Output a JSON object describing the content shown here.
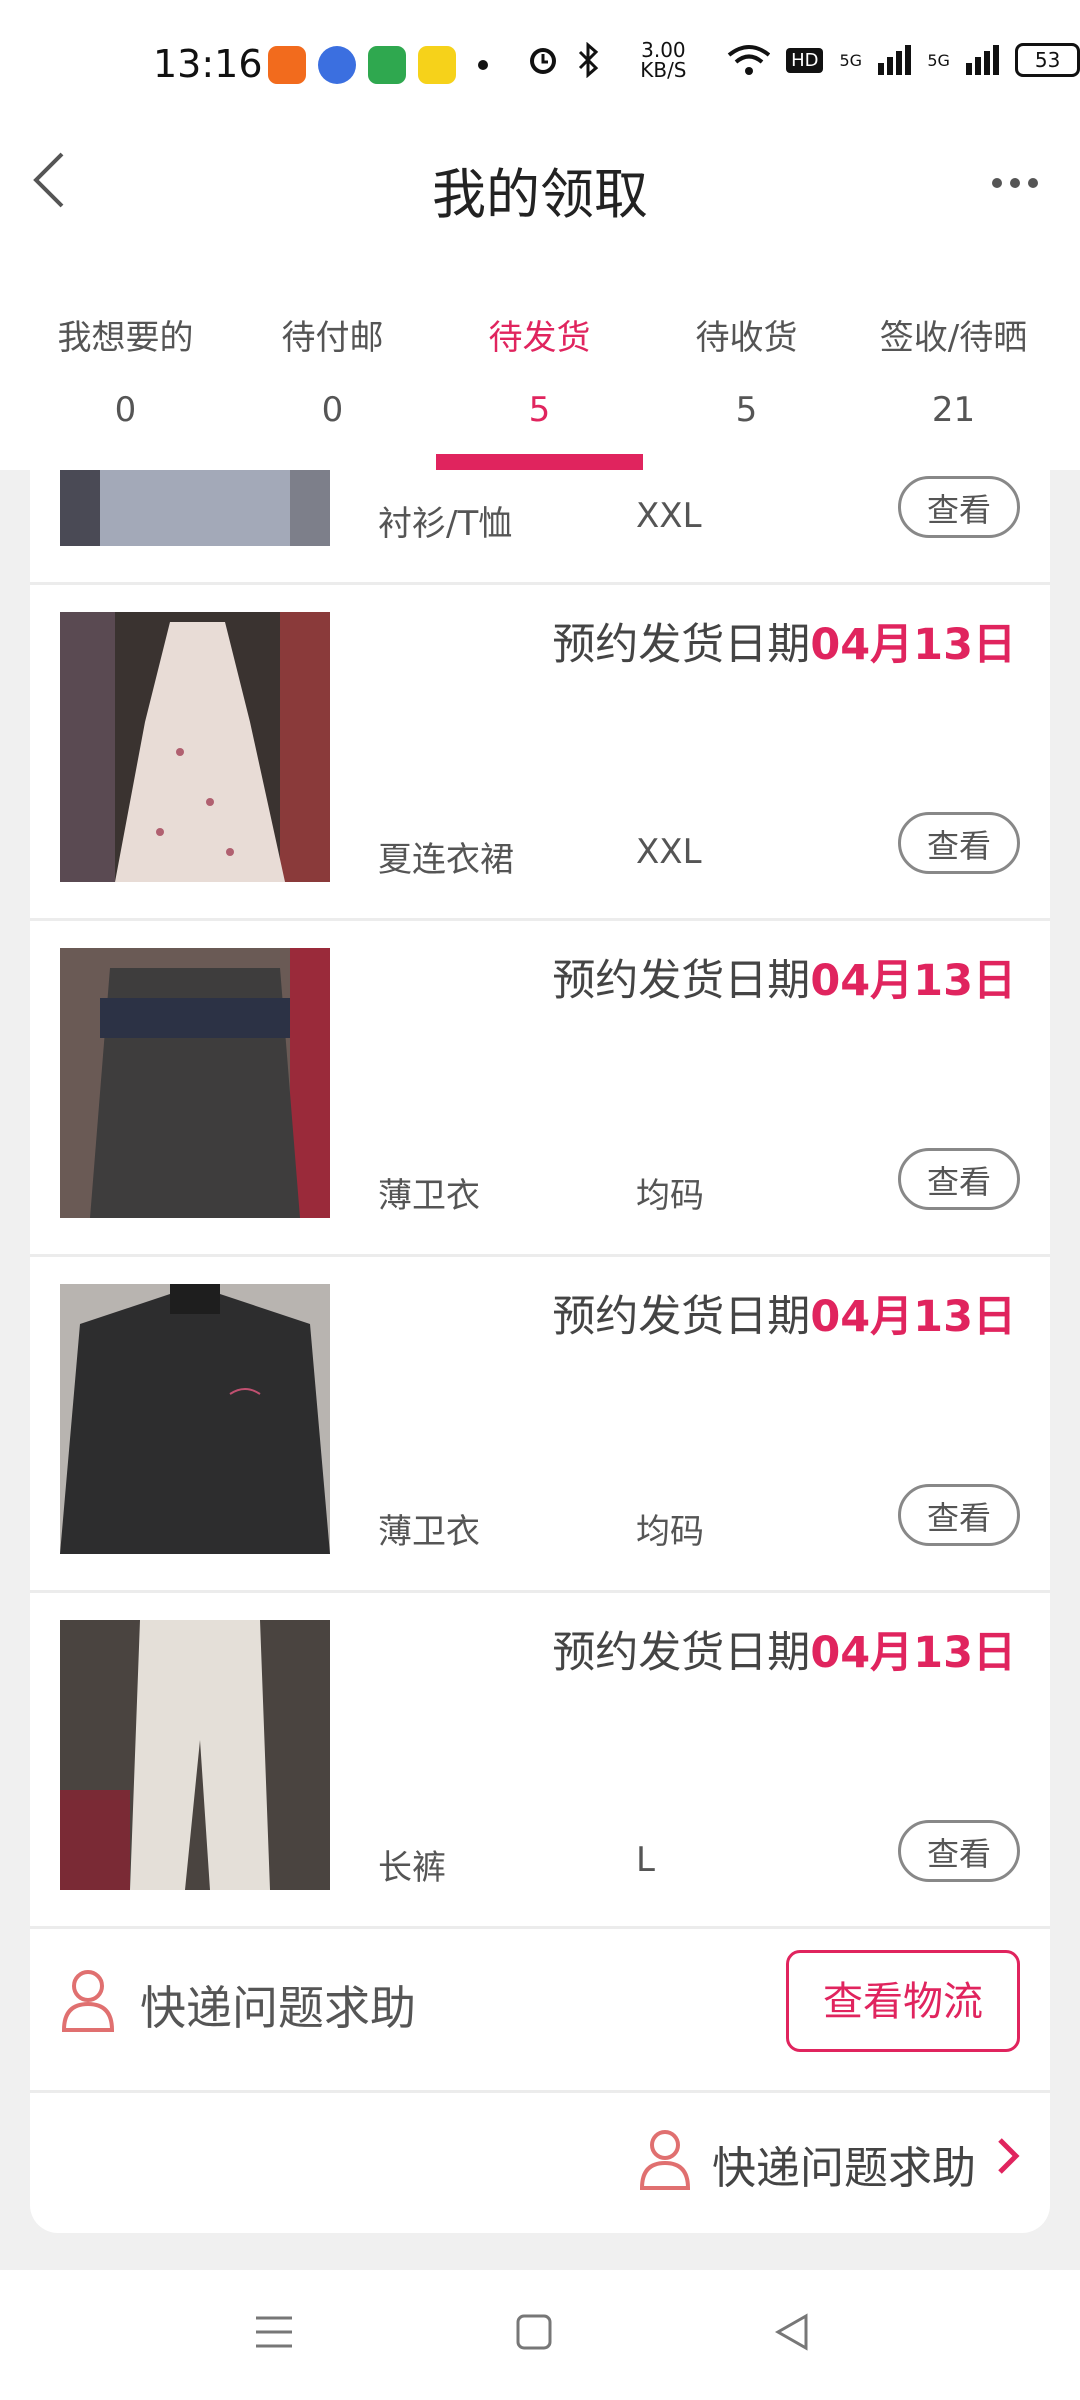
{
  "status": {
    "time": "13:16",
    "speed": "3.00 KB/S",
    "network": "5G",
    "battery": "53"
  },
  "header": {
    "title": "我的领取"
  },
  "tabs": [
    {
      "label": "我想要的",
      "count": "0"
    },
    {
      "label": "待付邮",
      "count": "0"
    },
    {
      "label": "待发货",
      "count": "5"
    },
    {
      "label": "待收货",
      "count": "5"
    },
    {
      "label": "签收/待晒",
      "count": "21"
    }
  ],
  "items": [
    {
      "category": "衬衫/T恤",
      "size": "XXL",
      "view_label": "查看"
    },
    {
      "date_prefix": "预约发货日期",
      "date_value": "04月13日",
      "category": "夏连衣裙",
      "size": "XXL",
      "view_label": "查看"
    },
    {
      "date_prefix": "预约发货日期",
      "date_value": "04月13日",
      "category": "薄卫衣",
      "size": "均码",
      "view_label": "查看"
    },
    {
      "date_prefix": "预约发货日期",
      "date_value": "04月13日",
      "category": "薄卫衣",
      "size": "均码",
      "view_label": "查看"
    },
    {
      "date_prefix": "预约发货日期",
      "date_value": "04月13日",
      "category": "长裤",
      "size": "L",
      "view_label": "查看"
    }
  ],
  "help": {
    "label": "快递问题求助",
    "logistics_button": "查看物流"
  },
  "help_footer": {
    "label": "快递问题求助"
  },
  "colors": {
    "accent": "#e0245e"
  }
}
